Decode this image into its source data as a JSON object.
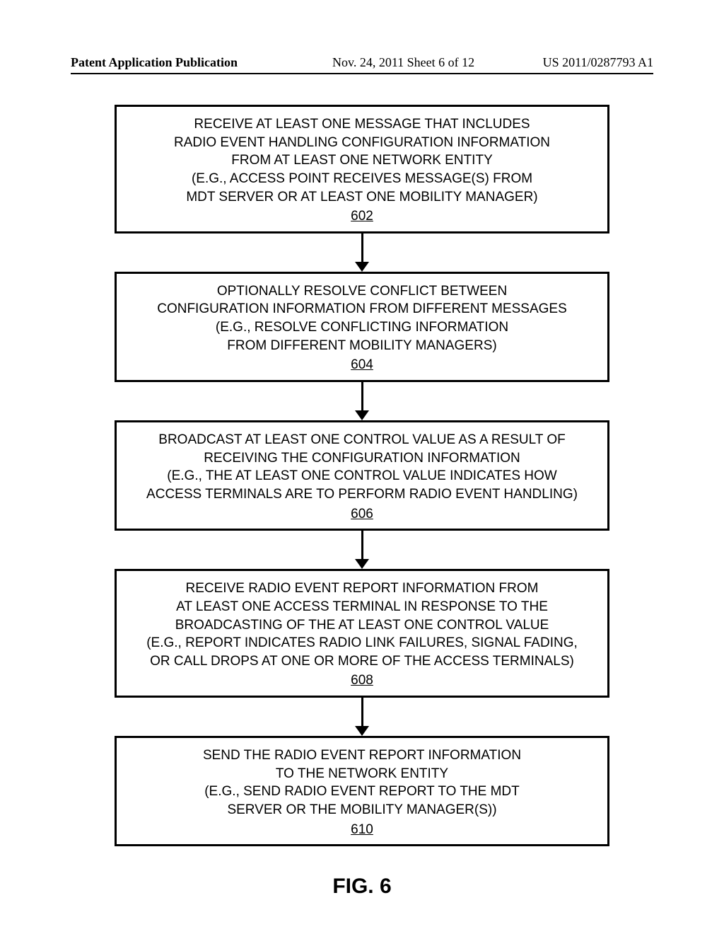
{
  "header": {
    "left": "Patent Application Publication",
    "mid": "Nov. 24, 2011  Sheet 6 of 12",
    "right": "US 2011/0287793 A1"
  },
  "steps": [
    {
      "lines": [
        "RECEIVE AT LEAST ONE MESSAGE THAT INCLUDES",
        "RADIO EVENT HANDLING CONFIGURATION INFORMATION",
        "FROM AT LEAST ONE NETWORK ENTITY",
        "(E.G., ACCESS POINT RECEIVES MESSAGE(S) FROM",
        "MDT SERVER OR AT LEAST ONE MOBILITY MANAGER)"
      ],
      "num": "602"
    },
    {
      "lines": [
        "OPTIONALLY RESOLVE CONFLICT BETWEEN",
        "CONFIGURATION INFORMATION FROM DIFFERENT MESSAGES",
        "(E.G., RESOLVE CONFLICTING INFORMATION",
        "FROM DIFFERENT MOBILITY MANAGERS)"
      ],
      "num": "604"
    },
    {
      "lines": [
        "BROADCAST AT LEAST ONE CONTROL VALUE AS A RESULT OF",
        "RECEIVING THE CONFIGURATION INFORMATION",
        "(E.G., THE AT LEAST ONE CONTROL VALUE INDICATES HOW",
        "ACCESS TERMINALS ARE TO PERFORM RADIO EVENT HANDLING)"
      ],
      "num": "606"
    },
    {
      "lines": [
        "RECEIVE RADIO EVENT REPORT INFORMATION FROM",
        "AT LEAST ONE ACCESS TERMINAL IN RESPONSE TO THE",
        "BROADCASTING OF THE AT LEAST ONE CONTROL VALUE",
        "(E.G., REPORT INDICATES RADIO LINK FAILURES, SIGNAL FADING,",
        "OR CALL DROPS AT ONE OR MORE OF THE ACCESS TERMINALS)"
      ],
      "num": "608"
    },
    {
      "lines": [
        "SEND THE RADIO EVENT REPORT INFORMATION",
        "TO THE NETWORK ENTITY",
        "(E.G., SEND RADIO EVENT REPORT TO THE MDT",
        "SERVER OR THE MOBILITY MANAGER(S))"
      ],
      "num": "610"
    }
  ],
  "figure_label": "FIG. 6"
}
